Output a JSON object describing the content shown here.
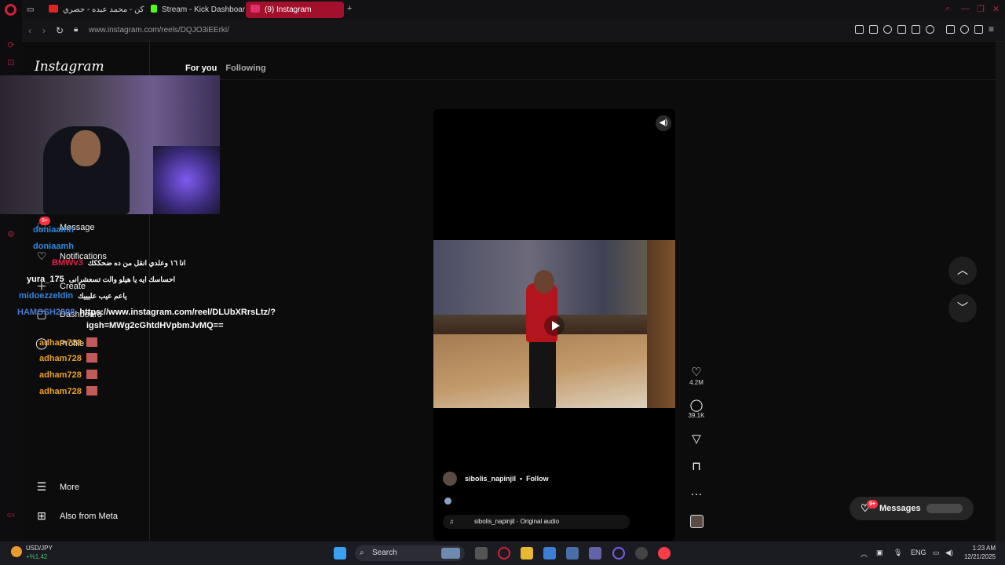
{
  "browser": {
    "tabs": [
      {
        "label": "الماكن - محمد عبده - حصري",
        "fav_color": "#e02424"
      },
      {
        "label": "Stream - Kick Dashboard",
        "fav_color": "#53fc18"
      },
      {
        "label": "(9) Instagram",
        "fav_color": "#e1306c"
      }
    ],
    "url": "www.instagram.com/reels/DQJO3iEErki/",
    "accent": "#a3102b"
  },
  "instagram": {
    "logo": "Instagram",
    "nav": {
      "message": "Message",
      "message_badge": "9+",
      "notifications": "Notifications",
      "create": "Create",
      "dashboard": "Dashboard",
      "profile": "Profile",
      "more": "More",
      "also_from_meta": "Also from Meta"
    },
    "feed_tabs": {
      "for_you": "For you",
      "following": "Following"
    },
    "reel": {
      "username": "sibolis_napinjil",
      "dot": "•",
      "follow": "Follow",
      "audio": "sibolis_napinjil · Original audio",
      "likes": "4.2M",
      "comments": "39.1K"
    },
    "messages": {
      "label": "Messages",
      "badge": "9+"
    }
  },
  "chat": [
    {
      "user": "doniaamh",
      "msg": "",
      "color": "#2e86de"
    },
    {
      "user": "doniaamh",
      "msg": "",
      "color": "#2e86de"
    },
    {
      "user": "BMWv3",
      "msg": "انا ١٦ وعلدي انقل من ده ضحككك",
      "color": "#e0204a"
    },
    {
      "user": "yura_175",
      "msg": "احساسك ايه يا هيلو والت تسعشرانى",
      "color": "#ffffff"
    },
    {
      "user": "midoezzeldin",
      "msg": "ياعم عيب عليييك",
      "color": "#2e86de"
    },
    {
      "user": "HAMOSH2008",
      "msg": "https://www.instagram.com/reel/DLUbXRrsLtz/?",
      "color": "#4a7bd0"
    },
    {
      "user": "",
      "msg": "igsh=MWg2cGhtdHVpbmJvMQ==",
      "color": "#ffffff"
    },
    {
      "user": "adham728",
      "msg": "",
      "color": "#e8a020"
    },
    {
      "user": "adham728",
      "msg": "",
      "color": "#e8a020"
    },
    {
      "user": "adham728",
      "msg": "",
      "color": "#e8a020"
    },
    {
      "user": "adham728",
      "msg": "",
      "color": "#e8a020"
    }
  ],
  "taskbar": {
    "search": "Search",
    "ticker_name": "USD/JPY",
    "ticker_change": "+%1.42",
    "lang": "ENG",
    "time": "1:23 AM",
    "date": "12/21/2025"
  }
}
